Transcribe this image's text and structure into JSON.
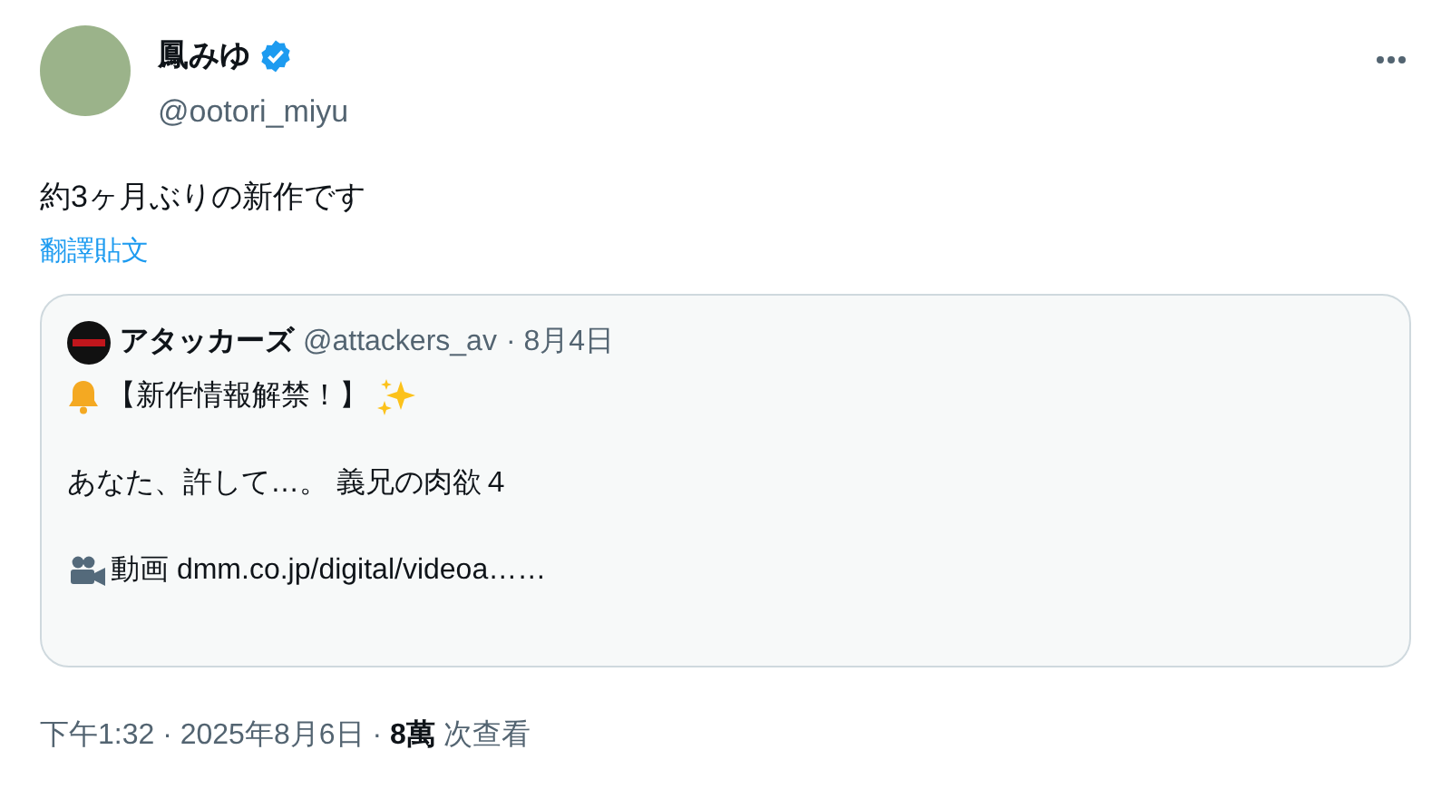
{
  "author": {
    "name": "鳳みゆ",
    "verified": true,
    "handle": "@ootori_miyu"
  },
  "text": "約3ヶ月ぶりの新作です",
  "translate_link": "翻譯貼文",
  "quote": {
    "name": "アタッカーズ",
    "handle": "@attackers_av",
    "date": "· 8月4日",
    "lines": [
      {
        "kind": "announcement",
        "text": "【新作情報解禁！】"
      },
      {
        "kind": "text",
        "text": "あなた、許して…。 義兄の肉欲４"
      },
      {
        "kind": "video",
        "text": "動画 dmm.co.jp/digital/videoa……"
      }
    ]
  },
  "footer": "下午1:32 · 2025年8月6日 · **8萬** 次查看"
}
